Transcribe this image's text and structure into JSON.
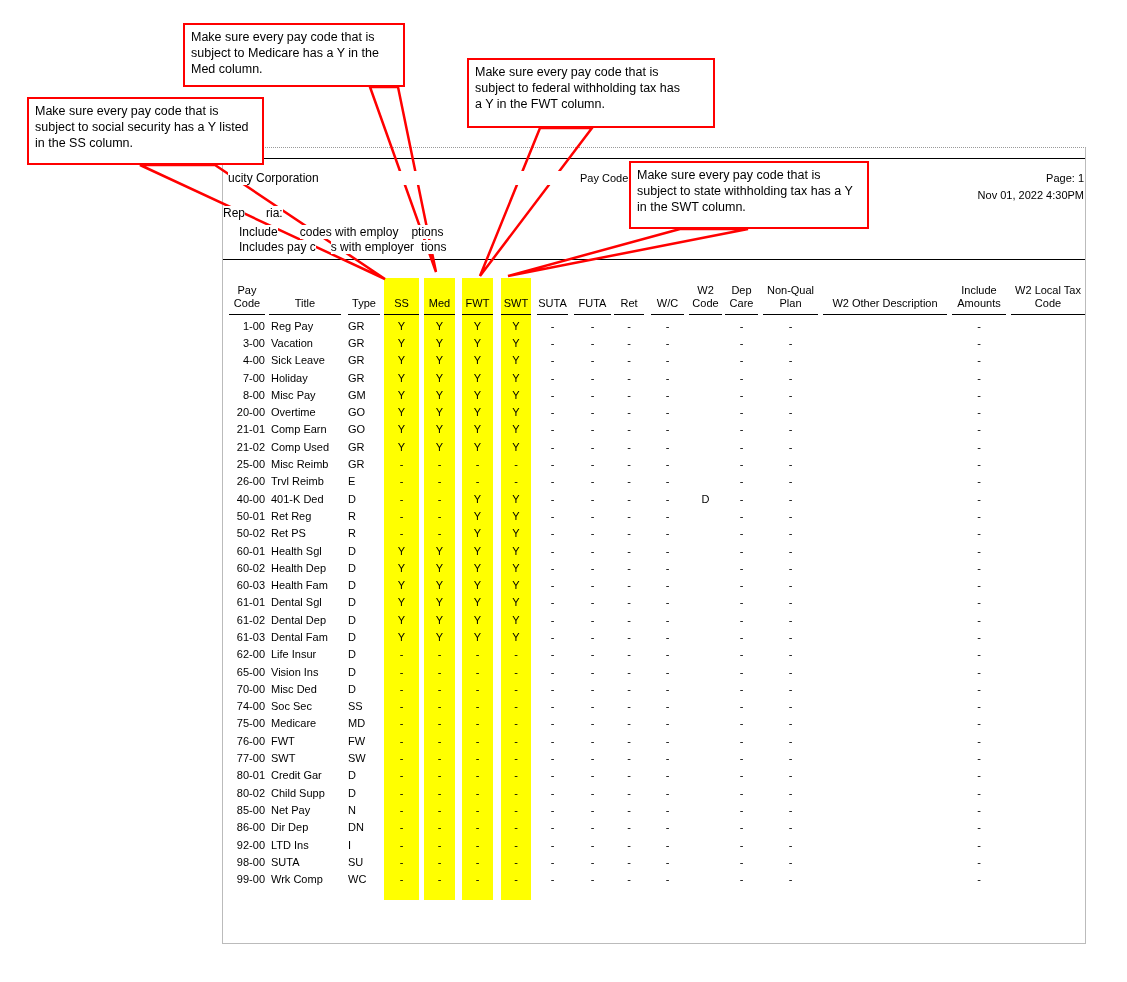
{
  "report": {
    "company": "ucity Corporation",
    "title": "Pay Code",
    "page": "Page: 1",
    "date": "Nov 01, 2022 4:30PM",
    "criteria": [
      [
        "Rep",
        "ria:"
      ],
      [
        "Include",
        "codes with employ",
        "ptions"
      ],
      [
        "Includes pay c",
        "s with employer",
        "tions"
      ]
    ],
    "table": {
      "columns": [
        {
          "label": "Pay Code",
          "highlighted": false
        },
        {
          "label": "Title",
          "highlighted": false
        },
        {
          "label": "Type",
          "highlighted": false
        },
        {
          "label": "SS",
          "highlighted": true
        },
        {
          "label": "Med",
          "highlighted": true
        },
        {
          "label": "FWT",
          "highlighted": true
        },
        {
          "label": "SWT",
          "highlighted": true
        },
        {
          "label": "SUTA",
          "highlighted": false
        },
        {
          "label": "FUTA",
          "highlighted": false
        },
        {
          "label": "Ret",
          "highlighted": false
        },
        {
          "label": "W/C",
          "highlighted": false
        },
        {
          "label": "W2 Code",
          "highlighted": false
        },
        {
          "label": "Dep Care",
          "highlighted": false
        },
        {
          "label": "Non-Qual Plan",
          "highlighted": false
        },
        {
          "label": "W2 Other Description",
          "highlighted": false
        },
        {
          "label": "Include Amounts",
          "highlighted": false
        },
        {
          "label": "W2 Local Tax Code",
          "highlighted": false
        }
      ],
      "rows": [
        [
          "1-00",
          "Reg Pay",
          "GR",
          "Y",
          "Y",
          "Y",
          "Y",
          "-",
          "-",
          "-",
          "-",
          null,
          "-",
          "-",
          null,
          "-",
          null
        ],
        [
          "3-00",
          "Vacation",
          "GR",
          "Y",
          "Y",
          "Y",
          "Y",
          "-",
          "-",
          "-",
          "-",
          null,
          "-",
          "-",
          null,
          "-",
          null
        ],
        [
          "4-00",
          "Sick Leave",
          "GR",
          "Y",
          "Y",
          "Y",
          "Y",
          "-",
          "-",
          "-",
          "-",
          null,
          "-",
          "-",
          null,
          "-",
          null
        ],
        [
          "7-00",
          "Holiday",
          "GR",
          "Y",
          "Y",
          "Y",
          "Y",
          "-",
          "-",
          "-",
          "-",
          null,
          "-",
          "-",
          null,
          "-",
          null
        ],
        [
          "8-00",
          "Misc Pay",
          "GM",
          "Y",
          "Y",
          "Y",
          "Y",
          "-",
          "-",
          "-",
          "-",
          null,
          "-",
          "-",
          null,
          "-",
          null
        ],
        [
          "20-00",
          "Overtime",
          "GO",
          "Y",
          "Y",
          "Y",
          "Y",
          "-",
          "-",
          "-",
          "-",
          null,
          "-",
          "-",
          null,
          "-",
          null
        ],
        [
          "21-01",
          "Comp Earn",
          "GO",
          "Y",
          "Y",
          "Y",
          "Y",
          "-",
          "-",
          "-",
          "-",
          null,
          "-",
          "-",
          null,
          "-",
          null
        ],
        [
          "21-02",
          "Comp Used",
          "GR",
          "Y",
          "Y",
          "Y",
          "Y",
          "-",
          "-",
          "-",
          "-",
          null,
          "-",
          "-",
          null,
          "-",
          null
        ],
        [
          "25-00",
          "Misc Reimb",
          "GR",
          "-",
          "-",
          "-",
          "-",
          "-",
          "-",
          "-",
          "-",
          null,
          "-",
          "-",
          null,
          "-",
          null
        ],
        [
          "26-00",
          "Trvl Reimb",
          "E",
          "-",
          "-",
          "-",
          "-",
          "-",
          "-",
          "-",
          "-",
          null,
          "-",
          "-",
          null,
          "-",
          null
        ],
        [
          "40-00",
          "401-K Ded",
          "D",
          "-",
          "-",
          "Y",
          "Y",
          "-",
          "-",
          "-",
          "-",
          "D",
          "-",
          "-",
          null,
          "-",
          null
        ],
        [
          "50-01",
          "Ret Reg",
          "R",
          "-",
          "-",
          "Y",
          "Y",
          "-",
          "-",
          "-",
          "-",
          null,
          "-",
          "-",
          null,
          "-",
          null
        ],
        [
          "50-02",
          "Ret PS",
          "R",
          "-",
          "-",
          "Y",
          "Y",
          "-",
          "-",
          "-",
          "-",
          null,
          "-",
          "-",
          null,
          "-",
          null
        ],
        [
          "60-01",
          "Health Sgl",
          "D",
          "Y",
          "Y",
          "Y",
          "Y",
          "-",
          "-",
          "-",
          "-",
          null,
          "-",
          "-",
          null,
          "-",
          null
        ],
        [
          "60-02",
          "Health Dep",
          "D",
          "Y",
          "Y",
          "Y",
          "Y",
          "-",
          "-",
          "-",
          "-",
          null,
          "-",
          "-",
          null,
          "-",
          null
        ],
        [
          "60-03",
          "Health Fam",
          "D",
          "Y",
          "Y",
          "Y",
          "Y",
          "-",
          "-",
          "-",
          "-",
          null,
          "-",
          "-",
          null,
          "-",
          null
        ],
        [
          "61-01",
          "Dental Sgl",
          "D",
          "Y",
          "Y",
          "Y",
          "Y",
          "-",
          "-",
          "-",
          "-",
          null,
          "-",
          "-",
          null,
          "-",
          null
        ],
        [
          "61-02",
          "Dental Dep",
          "D",
          "Y",
          "Y",
          "Y",
          "Y",
          "-",
          "-",
          "-",
          "-",
          null,
          "-",
          "-",
          null,
          "-",
          null
        ],
        [
          "61-03",
          "Dental Fam",
          "D",
          "Y",
          "Y",
          "Y",
          "Y",
          "-",
          "-",
          "-",
          "-",
          null,
          "-",
          "-",
          null,
          "-",
          null
        ],
        [
          "62-00",
          "Life Insur",
          "D",
          "-",
          "-",
          "-",
          "-",
          "-",
          "-",
          "-",
          "-",
          null,
          "-",
          "-",
          null,
          "-",
          null
        ],
        [
          "65-00",
          "Vision Ins",
          "D",
          "-",
          "-",
          "-",
          "-",
          "-",
          "-",
          "-",
          "-",
          null,
          "-",
          "-",
          null,
          "-",
          null
        ],
        [
          "70-00",
          "Misc Ded",
          "D",
          "-",
          "-",
          "-",
          "-",
          "-",
          "-",
          "-",
          "-",
          null,
          "-",
          "-",
          null,
          "-",
          null
        ],
        [
          "74-00",
          "Soc Sec",
          "SS",
          "-",
          "-",
          "-",
          "-",
          "-",
          "-",
          "-",
          "-",
          null,
          "-",
          "-",
          null,
          "-",
          null
        ],
        [
          "75-00",
          "Medicare",
          "MD",
          "-",
          "-",
          "-",
          "-",
          "-",
          "-",
          "-",
          "-",
          null,
          "-",
          "-",
          null,
          "-",
          null
        ],
        [
          "76-00",
          "FWT",
          "FW",
          "-",
          "-",
          "-",
          "-",
          "-",
          "-",
          "-",
          "-",
          null,
          "-",
          "-",
          null,
          "-",
          null
        ],
        [
          "77-00",
          "SWT",
          "SW",
          "-",
          "-",
          "-",
          "-",
          "-",
          "-",
          "-",
          "-",
          null,
          "-",
          "-",
          null,
          "-",
          null
        ],
        [
          "80-01",
          "Credit Gar",
          "D",
          "-",
          "-",
          "-",
          "-",
          "-",
          "-",
          "-",
          "-",
          null,
          "-",
          "-",
          null,
          "-",
          null
        ],
        [
          "80-02",
          "Child Supp",
          "D",
          "-",
          "-",
          "-",
          "-",
          "-",
          "-",
          "-",
          "-",
          null,
          "-",
          "-",
          null,
          "-",
          null
        ],
        [
          "85-00",
          "Net Pay",
          "N",
          "-",
          "-",
          "-",
          "-",
          "-",
          "-",
          "-",
          "-",
          null,
          "-",
          "-",
          null,
          "-",
          null
        ],
        [
          "86-00",
          "Dir Dep",
          "DN",
          "-",
          "-",
          "-",
          "-",
          "-",
          "-",
          "-",
          "-",
          null,
          "-",
          "-",
          null,
          "-",
          null
        ],
        [
          "92-00",
          "LTD Ins",
          "I",
          "-",
          "-",
          "-",
          "-",
          "-",
          "-",
          "-",
          "-",
          null,
          "-",
          "-",
          null,
          "-",
          null
        ],
        [
          "98-00",
          "SUTA",
          "SU",
          "-",
          "-",
          "-",
          "-",
          "-",
          "-",
          "-",
          "-",
          null,
          "-",
          "-",
          null,
          "-",
          null
        ],
        [
          "99-00",
          "Wrk Comp",
          "WC",
          "-",
          "-",
          "-",
          "-",
          "-",
          "-",
          "-",
          "-",
          null,
          "-",
          "-",
          null,
          "-",
          null
        ]
      ]
    }
  },
  "callouts": [
    {
      "text": "Make sure every pay code that is subject to social security has a Y listed in the SS column."
    },
    {
      "text": "Make sure every pay code that is subject to Medicare has a Y in the Med column."
    },
    {
      "text": "Make sure every pay code that is subject to federal withholding tax has a Y in the FWT column."
    },
    {
      "text": "Make sure every pay code that is subject to state withholding tax has a Y in the SWT column."
    }
  ]
}
